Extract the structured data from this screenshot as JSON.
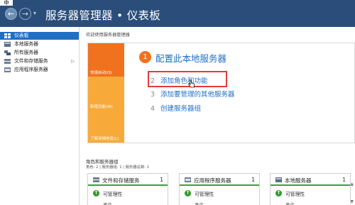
{
  "window": {
    "corner_glyph": "中",
    "title": "服务器管理器 • 仪表板"
  },
  "nav": {
    "back_glyph": "←",
    "forward_glyph": "→",
    "dropdown_glyph": "▾"
  },
  "sidebar": {
    "items": [
      {
        "label": "仪表板",
        "icon": "dashboard-icon",
        "active": true
      },
      {
        "label": "本地服务器",
        "icon": "server-icon"
      },
      {
        "label": "所有服务器",
        "icon": "servers-icon"
      },
      {
        "label": "文件和存储服务",
        "icon": "storage-icon",
        "expand": "▷"
      },
      {
        "label": "应用程序服务器",
        "icon": "app-server-icon"
      }
    ]
  },
  "welcome": "欢迎使用服务器管理器",
  "tiles": {
    "quick": "快速启动(Q)",
    "new": "新增功能(W)",
    "learn": "了解详细信息(L)"
  },
  "quickstart": {
    "step1_number": "1",
    "step1_title": "配置此本地服务器",
    "steps": [
      {
        "num": "2",
        "label": "添加角色和功能"
      },
      {
        "num": "3",
        "label": "添加要管理的其他服务器"
      },
      {
        "num": "4",
        "label": "创建服务器组"
      }
    ]
  },
  "roles": {
    "title": "角色和服务器组",
    "subtitle": "角色: 2 | 服务器组: 1 | 服务器总数: 1"
  },
  "cards": [
    {
      "title": "文件和存储服务",
      "count": "1",
      "status": "可管理性",
      "event": "事件"
    },
    {
      "title": "应用程序服务器",
      "count": "1",
      "status": "可管理性",
      "event": "事件"
    },
    {
      "title": "本地服务器",
      "count": "1",
      "status": "可管理性",
      "event": "事件"
    }
  ],
  "colors": {
    "titlebar": "#2a4e79",
    "accent": "#1f6fc5",
    "orange": "#f0721f",
    "light_orange": "#f7aa3a",
    "status_green": "#3aa23a",
    "highlight_red": "#e53a3a"
  }
}
